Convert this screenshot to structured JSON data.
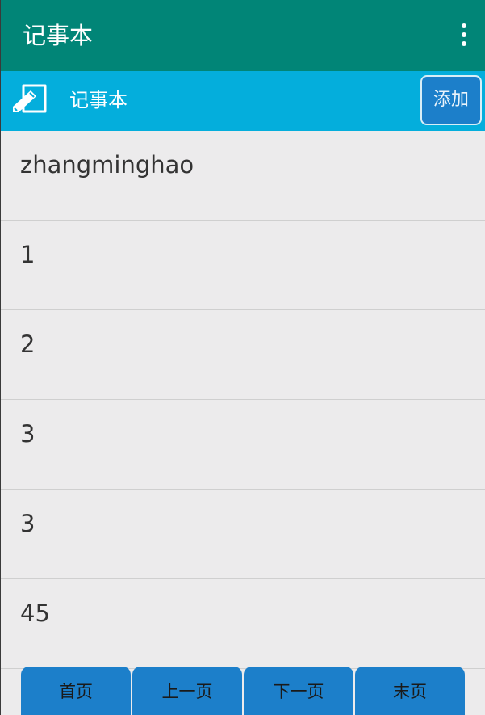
{
  "app_bar": {
    "title": "记事本",
    "menu_icon": "more-vert-icon"
  },
  "sub_bar": {
    "icon": "note-edit-icon",
    "title": "记事本",
    "add_label": "添加"
  },
  "notes": [
    "zhangminghao",
    "1",
    "2",
    "3",
    "3",
    "45"
  ],
  "pager": {
    "first_label": "首页",
    "prev_label": "上一页",
    "next_label": "下一页",
    "last_label": "末页"
  },
  "colors": {
    "app_bar": "#018577",
    "sub_bar": "#04aedc",
    "button": "#1c7fca",
    "list_background": "#ecebec"
  }
}
